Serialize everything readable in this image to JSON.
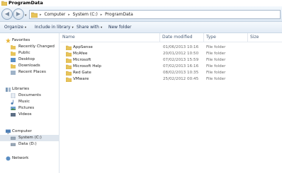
{
  "window": {
    "title": "ProgramData"
  },
  "address": {
    "crumbs": [
      "Computer",
      "System (C:)",
      "ProgramData"
    ],
    "separator": "▸"
  },
  "toolbar": {
    "organize": "Organize",
    "include": "Include in library",
    "share": "Share with",
    "new_folder": "New folder",
    "caret": "▾"
  },
  "sidebar": {
    "favorites": "Favorites",
    "recently_changed": "Recently Changed",
    "public": "Public",
    "desktop": "Desktop",
    "downloads": "Downloads",
    "recent_places": "Recent Places",
    "libraries": "Libraries",
    "documents": "Documents",
    "music": "Music",
    "pictures": "Pictures",
    "videos": "Videos",
    "computer": "Computer",
    "system_c": "System (C:)",
    "data_d": "Data (D:)",
    "network": "Network"
  },
  "columns": {
    "name": "Name",
    "date": "Date modified",
    "type": "Type",
    "size": "Size"
  },
  "files": [
    {
      "name": "AppSense",
      "date": "01/06/2013 10:16",
      "type": "File folder"
    },
    {
      "name": "McAfee",
      "date": "20/01/2012 10:50",
      "type": "File folder"
    },
    {
      "name": "Microsoft",
      "date": "07/02/2013 15:59",
      "type": "File folder"
    },
    {
      "name": "Microsoft Help",
      "date": "07/02/2013 16:16",
      "type": "File folder"
    },
    {
      "name": "Red Gate",
      "date": "08/02/2013 10:35",
      "type": "File folder"
    },
    {
      "name": "VMware",
      "date": "25/02/2012 00:45",
      "type": "File folder"
    }
  ],
  "colors": {
    "folder": "#e8c45a",
    "selected": "#dfe6ee"
  }
}
